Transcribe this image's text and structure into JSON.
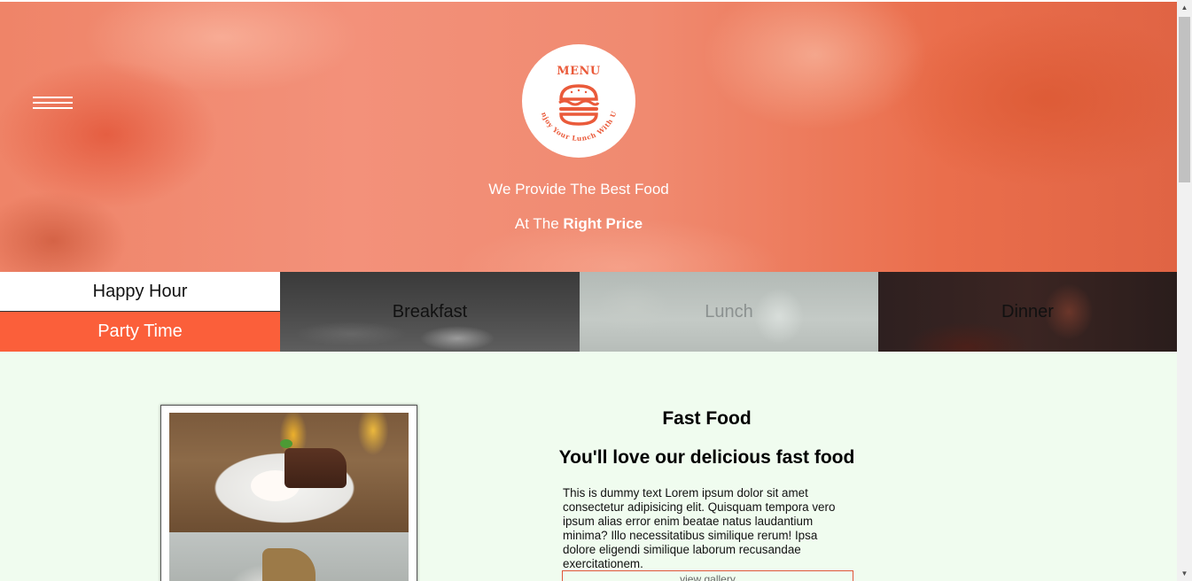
{
  "hero": {
    "logo_title": "MENU",
    "logo_tagline": "Enjoy Your Lunch With Us",
    "tagline_line1": "We Provide The Best Food",
    "tagline_line2_prefix": "At The ",
    "tagline_line2_bold": "Right Price"
  },
  "menubar": {
    "happy_hour": "Happy Hour",
    "party_time": "Party Time",
    "breakfast": "Breakfast",
    "lunch": "Lunch",
    "dinner": "Dinner"
  },
  "content": {
    "title": "Fast Food",
    "subtitle": "You'll love our delicious fast food",
    "body": "This is dummy text Lorem ipsum dolor sit amet consectetur adipisicing elit. Quisquam tempora vero ipsum alias error enim beatae natus laudantium minima? Illo necessitatibus similique rerum! Ipsa dolore eligendi similique laborum recusandae exercitationem.",
    "gallery_button": "view gallery"
  },
  "colors": {
    "accent": "#fb5f3a",
    "hero_overlay": "#f08a70",
    "content_bg": "#f0fcef"
  }
}
